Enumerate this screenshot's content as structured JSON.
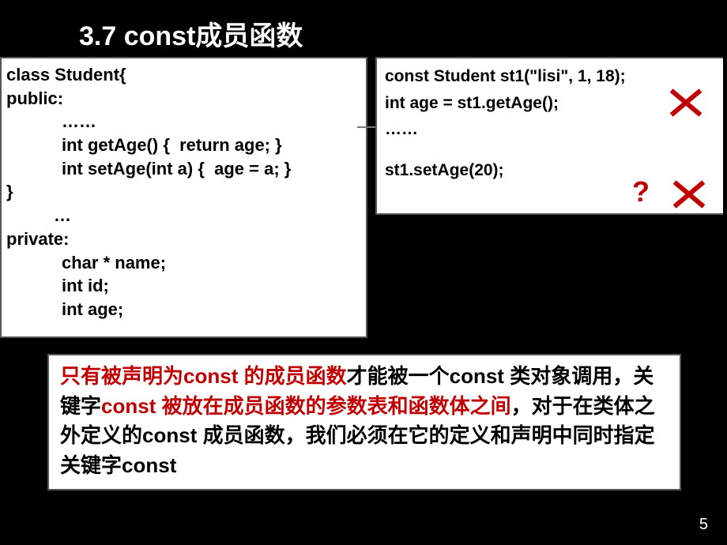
{
  "title": "3.7 const成员函数",
  "left_code": {
    "l1": "class Student{",
    "l2": "public:",
    "l3": "……",
    "l4": "int getAge() {  return age; }",
    "l5": "int setAge(int a) {  age = a; }",
    "l6_close": "}",
    "l7": "…",
    "l8": "private:",
    "l9": "char * name;",
    "l10": "int id;",
    "l11": "int age;"
  },
  "right_code": {
    "r1": "const Student st1(\"lisi\", 1, 18);",
    "r2": "int age = st1.getAge();",
    "r3": "……",
    "r4": "st1.setAge(20);"
  },
  "qmark": "?",
  "explain": {
    "t1": "只有被声明为",
    "t2": "const ",
    "t3": "的成员函数",
    "t4": "才能被一个",
    "t5": "const ",
    "t6": "类对象调用，关键字",
    "t7": "const ",
    "t8": "被放在成员函数的参数表和函数体之间",
    "t9": "，对于在类体之外定义的",
    "t10": "const ",
    "t11": "成员函数，我们必须在它的定义和声明中同时指定关键字",
    "t12": "const"
  },
  "page_number": "5"
}
